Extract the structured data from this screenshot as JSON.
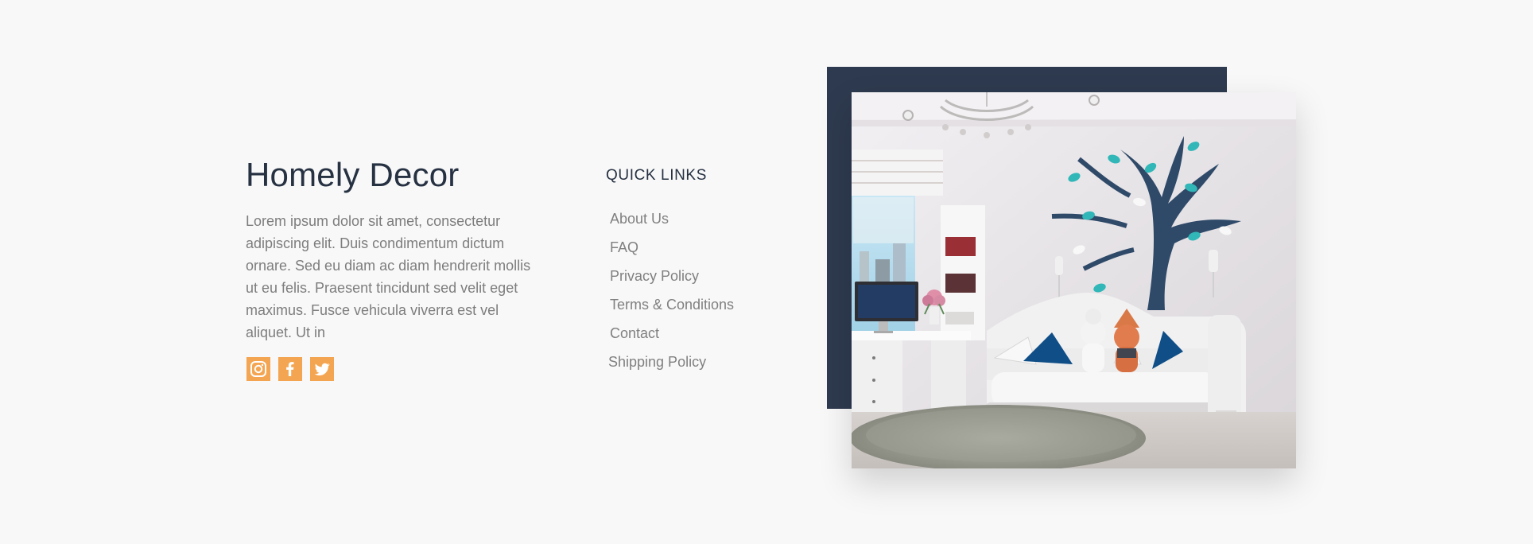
{
  "brand": {
    "title": "Homely Decor",
    "description": "Lorem ipsum dolor sit amet, consectetur adipiscing elit. Duis condimentum dictum ornare. Sed eu diam ac diam hendrerit mollis ut eu felis. Praesent tincidunt sed velit eget maximus. Fusce vehicula viverra est vel aliquet. Ut in"
  },
  "social": {
    "icons": [
      "instagram-icon",
      "facebook-icon",
      "twitter-icon"
    ],
    "accent": "#f4a552"
  },
  "quick_links": {
    "heading": "QUICK LINKS",
    "items": [
      {
        "label": "About Us"
      },
      {
        "label": "FAQ"
      },
      {
        "label": "Privacy Policy"
      },
      {
        "label": "Terms & Conditions"
      },
      {
        "label": "Contact"
      },
      {
        "label": "Shipping Policy"
      }
    ]
  },
  "colors": {
    "background": "#f8f8f8",
    "title": "#263142",
    "body_text": "#7d7d7d",
    "backdrop": "#2e3a4f"
  }
}
